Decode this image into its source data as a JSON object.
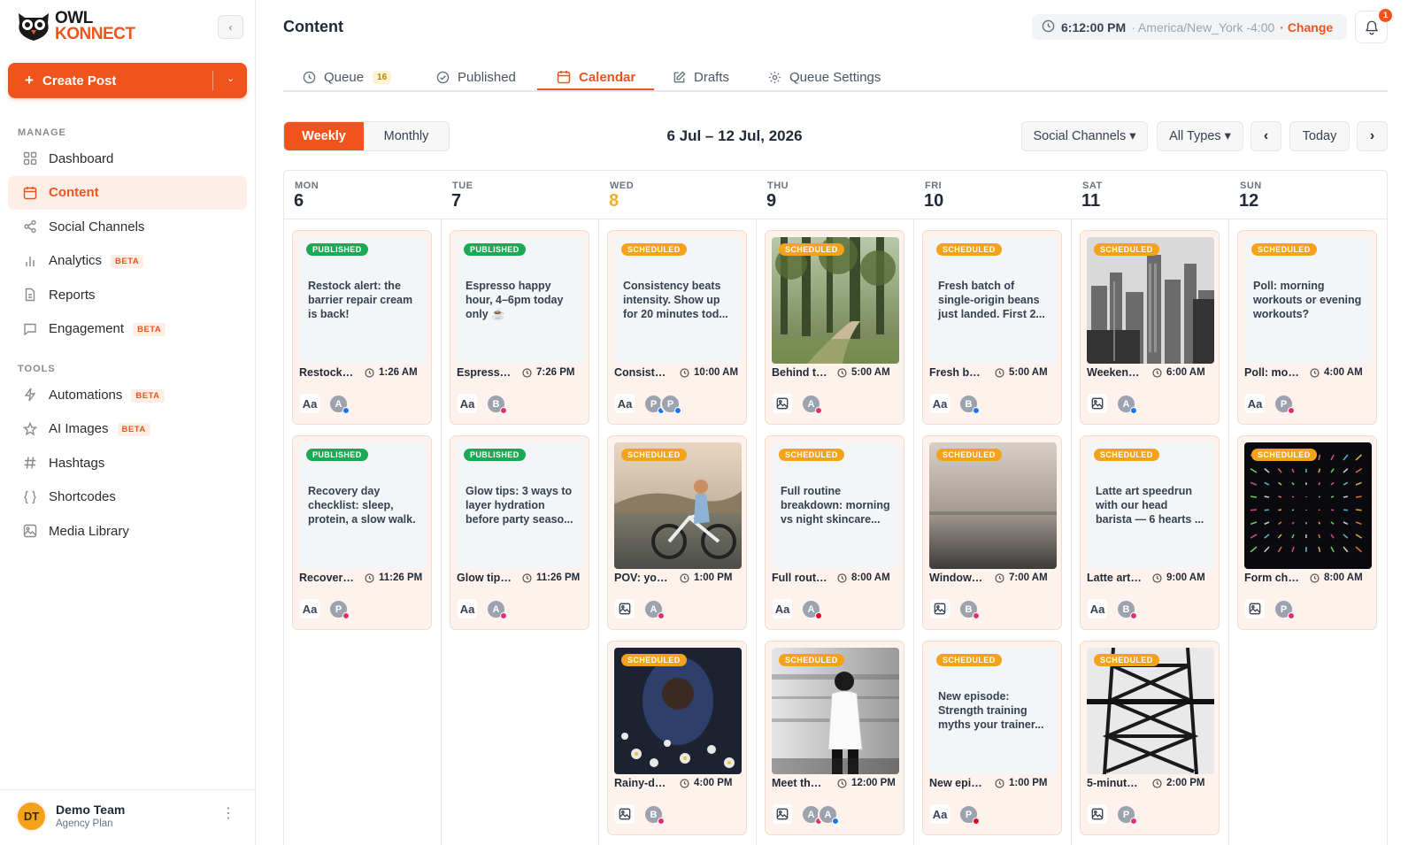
{
  "app": {
    "logo_line1": "OWL",
    "logo_line2": "KONNECT",
    "collapse_icon": "chevron-left-icon",
    "create_post_label": "Create Post",
    "brand_color": "#f0541d"
  },
  "sidebar": {
    "manage_label": "MANAGE",
    "tools_label": "TOOLS",
    "manage_items": [
      {
        "label": "Dashboard",
        "icon": "grid-icon",
        "active": false,
        "beta": ""
      },
      {
        "label": "Content",
        "icon": "calendar-icon",
        "active": true,
        "beta": ""
      },
      {
        "label": "Social Channels",
        "icon": "share-icon",
        "active": false,
        "beta": ""
      },
      {
        "label": "Analytics",
        "icon": "bar-chart-icon",
        "active": false,
        "beta": "BETA"
      },
      {
        "label": "Reports",
        "icon": "document-icon",
        "active": false,
        "beta": ""
      },
      {
        "label": "Engagement",
        "icon": "chat-icon",
        "active": false,
        "beta": "BETA"
      }
    ],
    "tool_items": [
      {
        "label": "Automations",
        "icon": "lightning-icon",
        "beta": "BETA"
      },
      {
        "label": "AI Images",
        "icon": "sparkle-icon",
        "beta": "BETA"
      },
      {
        "label": "Hashtags",
        "icon": "hash-icon",
        "beta": ""
      },
      {
        "label": "Shortcodes",
        "icon": "braces-icon",
        "beta": ""
      },
      {
        "label": "Media Library",
        "icon": "image-icon",
        "beta": ""
      }
    ],
    "user": {
      "initials": "DT",
      "name": "Demo Team",
      "plan": "Agency Plan"
    }
  },
  "header": {
    "title": "Content",
    "time": "6:12:00 PM",
    "timezone": "· America/New_York -4:00",
    "change_label": "· Change",
    "notification_count": "1"
  },
  "tabs": [
    {
      "label": "Queue",
      "icon": "clock-icon",
      "count": "16",
      "active": false
    },
    {
      "label": "Published",
      "icon": "check-circle-icon",
      "count": "",
      "active": false
    },
    {
      "label": "Calendar",
      "icon": "calendar-icon",
      "count": "",
      "active": true
    },
    {
      "label": "Drafts",
      "icon": "edit-icon",
      "count": "",
      "active": false
    },
    {
      "label": "Queue Settings",
      "icon": "gear-icon",
      "count": "",
      "active": false
    }
  ],
  "toolbar": {
    "weekly_label": "Weekly",
    "monthly_label": "Monthly",
    "date_range": "6 Jul – 12 Jul, 2026",
    "channels_label": "Social Channels ▾",
    "types_label": "All Types ▾",
    "today_label": "Today"
  },
  "status_colors": {
    "published": "#1aaa55",
    "scheduled": "#f4a21a"
  },
  "network_colors": {
    "facebook": "#1877f2",
    "instagram": "#e1306c",
    "pinterest": "#e60023"
  },
  "days": [
    {
      "name": "MON",
      "num": "6",
      "today": false,
      "posts": [
        {
          "status": "PUBLISHED",
          "kind": "text",
          "text": "Restock alert: the barrier repair cream is back!",
          "title": "Restock alert: the barrier repair cream is back!",
          "time": "1:26 AM",
          "format": "text",
          "avatars": [
            {
              "l": "A",
              "n": "facebook"
            }
          ]
        },
        {
          "status": "PUBLISHED",
          "kind": "text",
          "text": "Recovery day checklist: sleep, protein, a slow walk.",
          "title": "Recovery day checklist: sleep, protein, a slow walk.",
          "time": "11:26 PM",
          "format": "text",
          "avatars": [
            {
              "l": "P",
              "n": "instagram"
            }
          ]
        }
      ]
    },
    {
      "name": "TUE",
      "num": "7",
      "today": false,
      "posts": [
        {
          "status": "PUBLISHED",
          "kind": "text",
          "text": "Espresso happy hour, 4–6pm today only ☕",
          "title": "Espresso happy hour, 4–6pm today only ☕",
          "time": "7:26 PM",
          "format": "text",
          "avatars": [
            {
              "l": "B",
              "n": "instagram"
            }
          ]
        },
        {
          "status": "PUBLISHED",
          "kind": "text",
          "text": "Glow tips: 3 ways to layer hydration before party seaso...",
          "title": "Glow tips: 3 ways to layer hydration before party season",
          "time": "11:26 PM",
          "format": "text",
          "avatars": [
            {
              "l": "A",
              "n": "instagram"
            }
          ]
        }
      ]
    },
    {
      "name": "WED",
      "num": "8",
      "today": true,
      "posts": [
        {
          "status": "SCHEDULED",
          "kind": "text",
          "text": "Consistency beats intensity. Show up for 20 minutes tod...",
          "title": "Consistency beats intensity. Show up for 20 minutes today.",
          "time": "10:00 AM",
          "format": "text",
          "avatars": [
            {
              "l": "P",
              "n": "facebook"
            },
            {
              "l": "P",
              "n": "facebook"
            }
          ]
        },
        {
          "status": "SCHEDULED",
          "kind": "bike",
          "text": "",
          "title": "POV: you finally made time for a ride",
          "time": "1:00 PM",
          "format": "image",
          "avatars": [
            {
              "l": "A",
              "n": "instagram"
            }
          ]
        },
        {
          "status": "SCHEDULED",
          "kind": "flowers",
          "text": "",
          "title": "Rainy-day self care",
          "time": "4:00 PM",
          "format": "image",
          "avatars": [
            {
              "l": "B",
              "n": "instagram"
            }
          ]
        }
      ]
    },
    {
      "name": "THU",
      "num": "9",
      "today": false,
      "posts": [
        {
          "status": "SCHEDULED",
          "kind": "forest",
          "text": "",
          "title": "Behind the scenes",
          "time": "5:00 AM",
          "format": "image",
          "avatars": [
            {
              "l": "A",
              "n": "instagram"
            }
          ]
        },
        {
          "status": "SCHEDULED",
          "kind": "text",
          "text": "Full routine breakdown: morning vs night skincare...",
          "title": "Full routine breakdown: morning vs night skincare",
          "time": "8:00 AM",
          "format": "text",
          "avatars": [
            {
              "l": "A",
              "n": "pinterest"
            }
          ]
        },
        {
          "status": "SCHEDULED",
          "kind": "subway",
          "text": "",
          "title": "Meet the team",
          "time": "12:00 PM",
          "format": "image",
          "avatars": [
            {
              "l": "A",
              "n": "instagram"
            },
            {
              "l": "A",
              "n": "facebook"
            }
          ]
        }
      ]
    },
    {
      "name": "FRI",
      "num": "10",
      "today": false,
      "posts": [
        {
          "status": "SCHEDULED",
          "kind": "text",
          "text": "Fresh batch of single-origin beans just landed. First 2...",
          "title": "Fresh batch of single-origin beans just landed",
          "time": "5:00 AM",
          "format": "text",
          "avatars": [
            {
              "l": "B",
              "n": "facebook"
            }
          ]
        },
        {
          "status": "SCHEDULED",
          "kind": "fog",
          "text": "",
          "title": "Window seat views",
          "time": "7:00 AM",
          "format": "image",
          "avatars": [
            {
              "l": "B",
              "n": "instagram"
            }
          ]
        },
        {
          "status": "SCHEDULED",
          "kind": "text",
          "text": "New episode: Strength training myths your trainer...",
          "title": "New episode: Strength training myths your trainer",
          "time": "1:00 PM",
          "format": "text",
          "avatars": [
            {
              "l": "P",
              "n": "pinterest"
            }
          ]
        }
      ]
    },
    {
      "name": "SAT",
      "num": "11",
      "today": false,
      "posts": [
        {
          "status": "SCHEDULED",
          "kind": "city",
          "text": "",
          "title": "Weekend city guide",
          "time": "6:00 AM",
          "format": "image",
          "avatars": [
            {
              "l": "A",
              "n": "facebook"
            }
          ]
        },
        {
          "status": "SCHEDULED",
          "kind": "text",
          "text": "Latte art speedrun with our head barista — 6 hearts ...",
          "title": "Latte art speedrun with our head barista",
          "time": "9:00 AM",
          "format": "text",
          "avatars": [
            {
              "l": "B",
              "n": "instagram"
            }
          ]
        },
        {
          "status": "SCHEDULED",
          "kind": "tower",
          "text": "",
          "title": "5-minute warm up",
          "time": "2:00 PM",
          "format": "image",
          "avatars": [
            {
              "l": "P",
              "n": "instagram"
            }
          ]
        }
      ]
    },
    {
      "name": "SUN",
      "num": "12",
      "today": false,
      "posts": [
        {
          "status": "SCHEDULED",
          "kind": "text",
          "text": "Poll: morning workouts or evening workouts?",
          "title": "Poll: morning workouts or evening workouts?",
          "time": "4:00 AM",
          "format": "text",
          "avatars": [
            {
              "l": "P",
              "n": "instagram"
            }
          ]
        },
        {
          "status": "SCHEDULED",
          "kind": "fireworks",
          "text": "",
          "title": "Form check",
          "time": "8:00 AM",
          "format": "image",
          "avatars": [
            {
              "l": "P",
              "n": "instagram"
            }
          ]
        }
      ]
    }
  ]
}
